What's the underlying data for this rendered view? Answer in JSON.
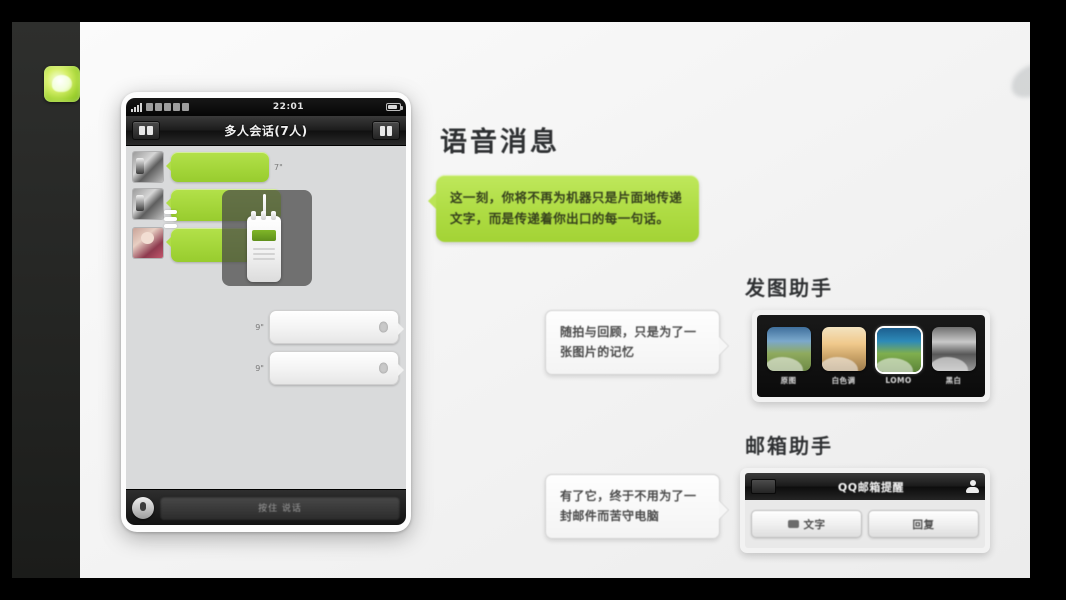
{
  "rail": {
    "app_icon": "wechat-leaf-icon"
  },
  "phone": {
    "status": {
      "time": "22:01",
      "signal": "signal-bars-icon",
      "battery": "battery-icon"
    },
    "nav": {
      "back": "back-button",
      "title": "多人会话(7人)",
      "contacts": "group-members-icon"
    },
    "messages": [
      {
        "side": "left",
        "avatar": "av1",
        "type": "voice",
        "duration": ""
      },
      {
        "side": "left",
        "avatar": "av1",
        "type": "voice",
        "duration": ""
      },
      {
        "side": "left",
        "avatar": "av2",
        "type": "voice",
        "duration": ""
      },
      {
        "side": "right",
        "avatar": "",
        "type": "voice",
        "duration": "9\""
      },
      {
        "side": "right",
        "avatar": "",
        "type": "voice",
        "duration": "9\""
      }
    ],
    "overlay": {
      "device": "walkie-talkie-illustration"
    },
    "input": {
      "mic": "microphone-button",
      "hold_label": "按住 说话"
    }
  },
  "voice_section": {
    "title": "语音消息",
    "bubble": "这一刻，你将不再为机器只是片面地传递文字，而是传递着你出口的每一句话。"
  },
  "photo_section": {
    "title": "发图助手",
    "callout": "随拍与回顾，只是为了一张图片的记忆",
    "filters": [
      {
        "label": "原图",
        "selected": false
      },
      {
        "label": "白色调",
        "selected": false
      },
      {
        "label": "LOMO",
        "selected": true
      },
      {
        "label": "黑白",
        "selected": false
      }
    ]
  },
  "mail_section": {
    "title": "邮箱助手",
    "callout": "有了它，终于不用为了一封邮件而苦守电脑",
    "widget": {
      "back": "back-button",
      "title": "QQ邮箱提醒",
      "person": "person-icon",
      "buttons": [
        {
          "label": "文字",
          "icon": "keyboard-icon"
        },
        {
          "label": "回复",
          "icon": ""
        }
      ]
    }
  },
  "colors": {
    "accent_green": "#a4d63a",
    "bubble_green": "#b0dd45",
    "dark_chrome": "#1a1a1a",
    "slide_bg": "#f4f4f4"
  }
}
